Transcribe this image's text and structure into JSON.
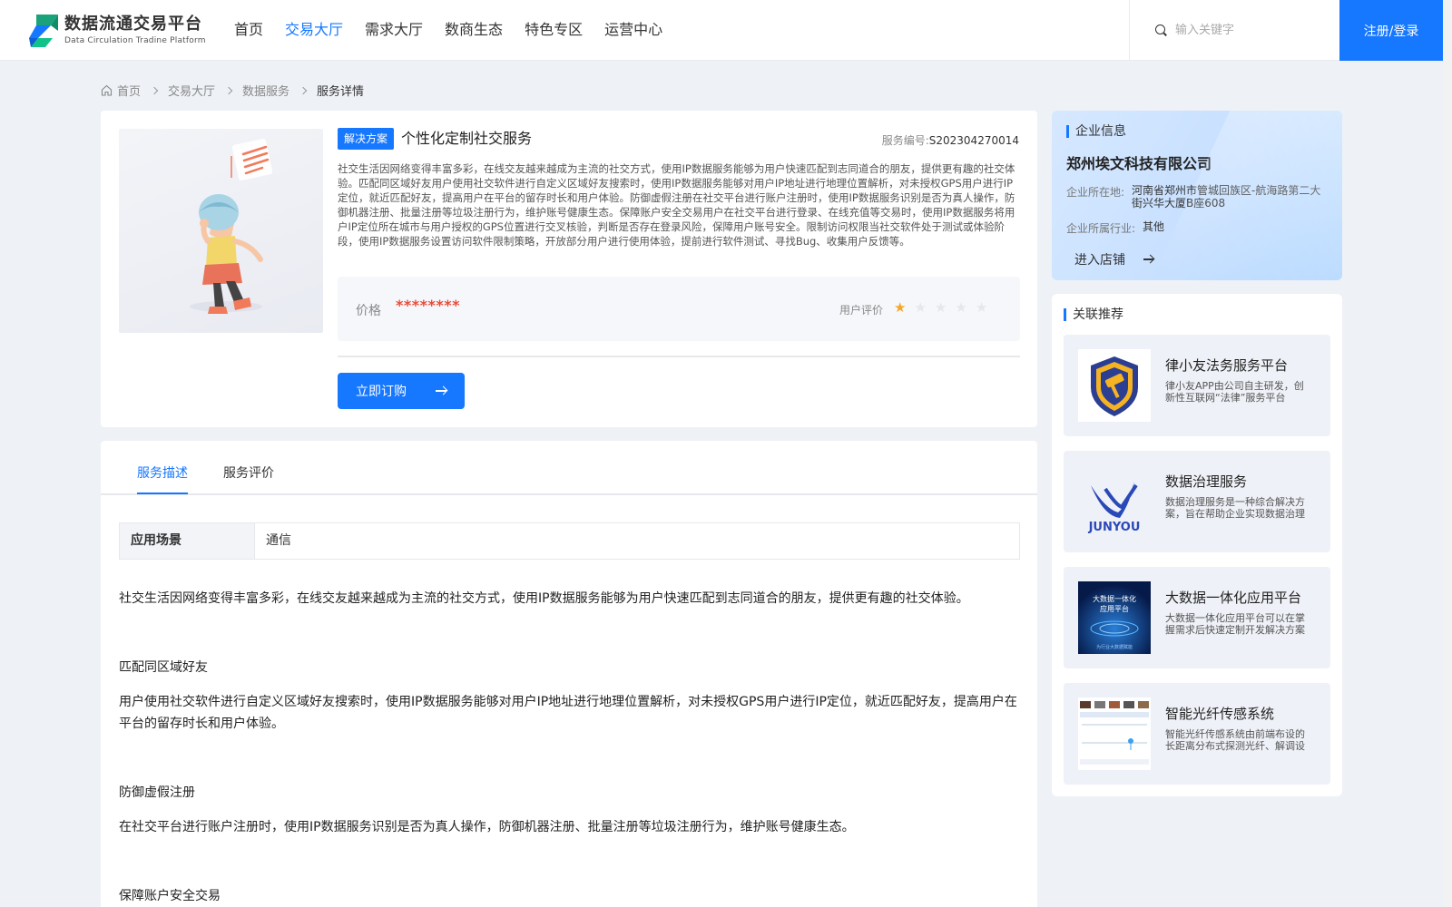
{
  "header": {
    "logo_cn": "数据流通交易平台",
    "logo_en": "Data Circulation Tradine Platform",
    "nav": [
      {
        "label": "首页",
        "active": false
      },
      {
        "label": "交易大厅",
        "active": true
      },
      {
        "label": "需求大厅",
        "active": false
      },
      {
        "label": "数商生态",
        "active": false
      },
      {
        "label": "特色专区",
        "active": false
      },
      {
        "label": "运营中心",
        "active": false
      }
    ],
    "search_placeholder": "输入关键字",
    "login_label": "注册/登录"
  },
  "breadcrumb": [
    "首页",
    "交易大厅",
    "数据服务",
    "服务详情"
  ],
  "product": {
    "tag": "解决方案",
    "title": "个性化定制社交服务",
    "service_no_label": "服务编号:",
    "service_no": "S202304270014",
    "description": "社交生活因网络变得丰富多彩，在线交友越来越成为主流的社交方式，使用IP数据服务能够为用户快速匹配到志同道合的朋友，提供更有趣的社交体验。匹配同区域好友用户使用社交软件进行自定义区域好友搜索时，使用IP数据服务能够对用户IP地址进行地理位置解析，对未授权GPS用户进行IP定位，就近匹配好友，提高用户在平台的留存时长和用户体验。防御虚假注册在社交平台进行账户注册时，使用IP数据服务识别是否为真人操作，防御机器注册、批量注册等垃圾注册行为，维护账号健康生态。保障账户安全交易用户在社交平台进行登录、在线充值等交易时，使用IP数据服务将用户IP定位所在城市与用户授权的GPS位置进行交叉核验，判断是否存在登录风险，保障用户账号安全。限制访问权限当社交软件处于测试或体验阶段，使用IP数据服务设置访问软件限制策略，开放部分用户进行使用体验，提前进行软件测试、寻找Bug、收集用户反馈等。",
    "price_label": "价格",
    "price_value": "********",
    "rating_label": "用户评价",
    "rating": 1,
    "rating_max": 5,
    "buy_label": "立即订购"
  },
  "detail": {
    "tabs": [
      {
        "label": "服务描述",
        "active": true
      },
      {
        "label": "服务评价",
        "active": false
      }
    ],
    "scene_key": "应用场景",
    "scene_value": "通信",
    "paragraphs": [
      "社交生活因网络变得丰富多彩，在线交友越来越成为主流的社交方式，使用IP数据服务能够为用户快速匹配到志同道合的朋友，提供更有趣的社交体验。",
      "匹配同区域好友",
      "用户使用社交软件进行自定义区域好友搜索时，使用IP数据服务能够对用户IP地址进行地理位置解析，对未授权GPS用户进行IP定位，就近匹配好友，提高用户在平台的留存时长和用户体验。",
      "防御虚假注册",
      "在社交平台进行账户注册时，使用IP数据服务识别是否为真人操作，防御机器注册、批量注册等垃圾注册行为，维护账号健康生态。",
      "保障账户安全交易"
    ]
  },
  "company": {
    "section_title": "企业信息",
    "name": "郑州埃文科技有限公司",
    "location_label": "企业所在地:",
    "location": "河南省郑州市管城回族区-航海路第二大街兴华大厦B座608",
    "industry_label": "企业所属行业:",
    "industry": "其他",
    "enter_store": "进入店铺"
  },
  "recommend": {
    "section_title": "关联推荐",
    "items": [
      {
        "name": "律小友法务服务平台",
        "desc": "律小友APP由公司自主研发，创新性互联网“法律”服务平台"
      },
      {
        "name": "数据治理服务",
        "desc": "数据治理服务是一种综合解决方案，旨在帮助企业实现数据治理"
      },
      {
        "name": "大数据一体化应用平台",
        "desc": "大数据一体化应用平台可以在掌握需求后快速定制开发解决方案"
      },
      {
        "name": "智能光纤传感系统",
        "desc": "智能光纤传感系统由前端布设的长距离分布式探测光纤、解调设备"
      }
    ],
    "thumb_texts": {
      "junyou": "JUNYOU",
      "bigdata_line1": "大数据一体化",
      "bigdata_line2": "应用平台",
      "bigdata_caption": "为行业大数据赋能"
    }
  },
  "colors": {
    "accent": "#1677ff",
    "price": "#e74c3c",
    "star": "#f5a623"
  }
}
